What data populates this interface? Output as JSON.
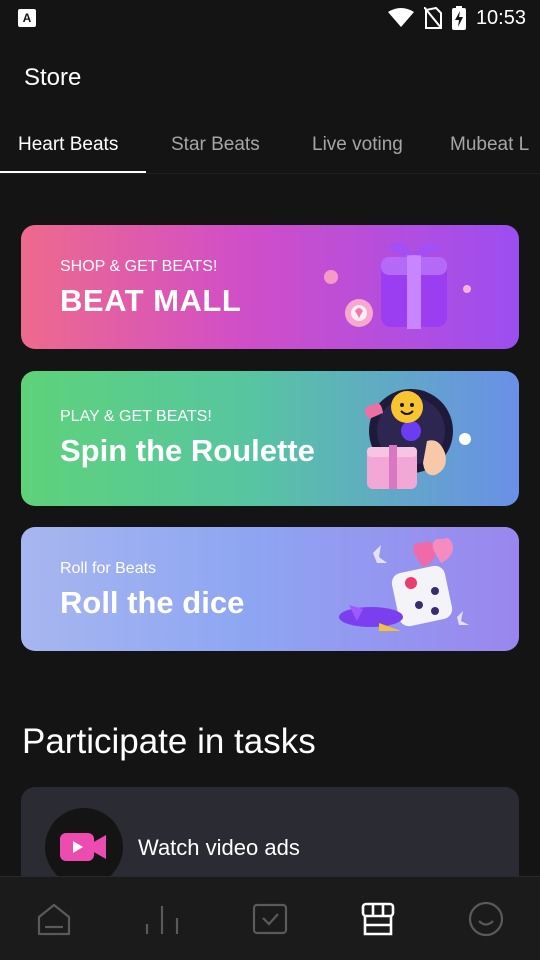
{
  "status_bar": {
    "time": "10:53",
    "left_badge": "A"
  },
  "header": {
    "title": "Store"
  },
  "tabs": [
    {
      "label": "Heart Beats",
      "active": true
    },
    {
      "label": "Star Beats",
      "active": false
    },
    {
      "label": "Live voting",
      "active": false
    },
    {
      "label": "Mubeat L",
      "active": false
    }
  ],
  "cards": [
    {
      "subtitle": "SHOP & GET BEATS!",
      "title": "BEAT MALL",
      "icon": "gift-box-icon"
    },
    {
      "subtitle": "PLAY & GET BEATS!",
      "title": "Spin the Roulette",
      "icon": "roulette-icon"
    },
    {
      "subtitle": "Roll for Beats",
      "title": "Roll the dice",
      "icon": "dice-icon"
    }
  ],
  "tasks_section": {
    "title": "Participate in tasks",
    "items": [
      {
        "label": "Watch video ads",
        "icon": "video-camera-icon"
      }
    ]
  },
  "bottom_nav": [
    {
      "icon": "home-icon",
      "active": false
    },
    {
      "icon": "chart-icon",
      "active": false
    },
    {
      "icon": "check-box-icon",
      "active": false
    },
    {
      "icon": "store-icon",
      "active": true
    },
    {
      "icon": "profile-icon",
      "active": false
    }
  ],
  "colors": {
    "background": "#141414",
    "tab_inactive": "#a6a6a6",
    "task_card": "#2a2b33",
    "video_icon": "#ec4bb0"
  }
}
